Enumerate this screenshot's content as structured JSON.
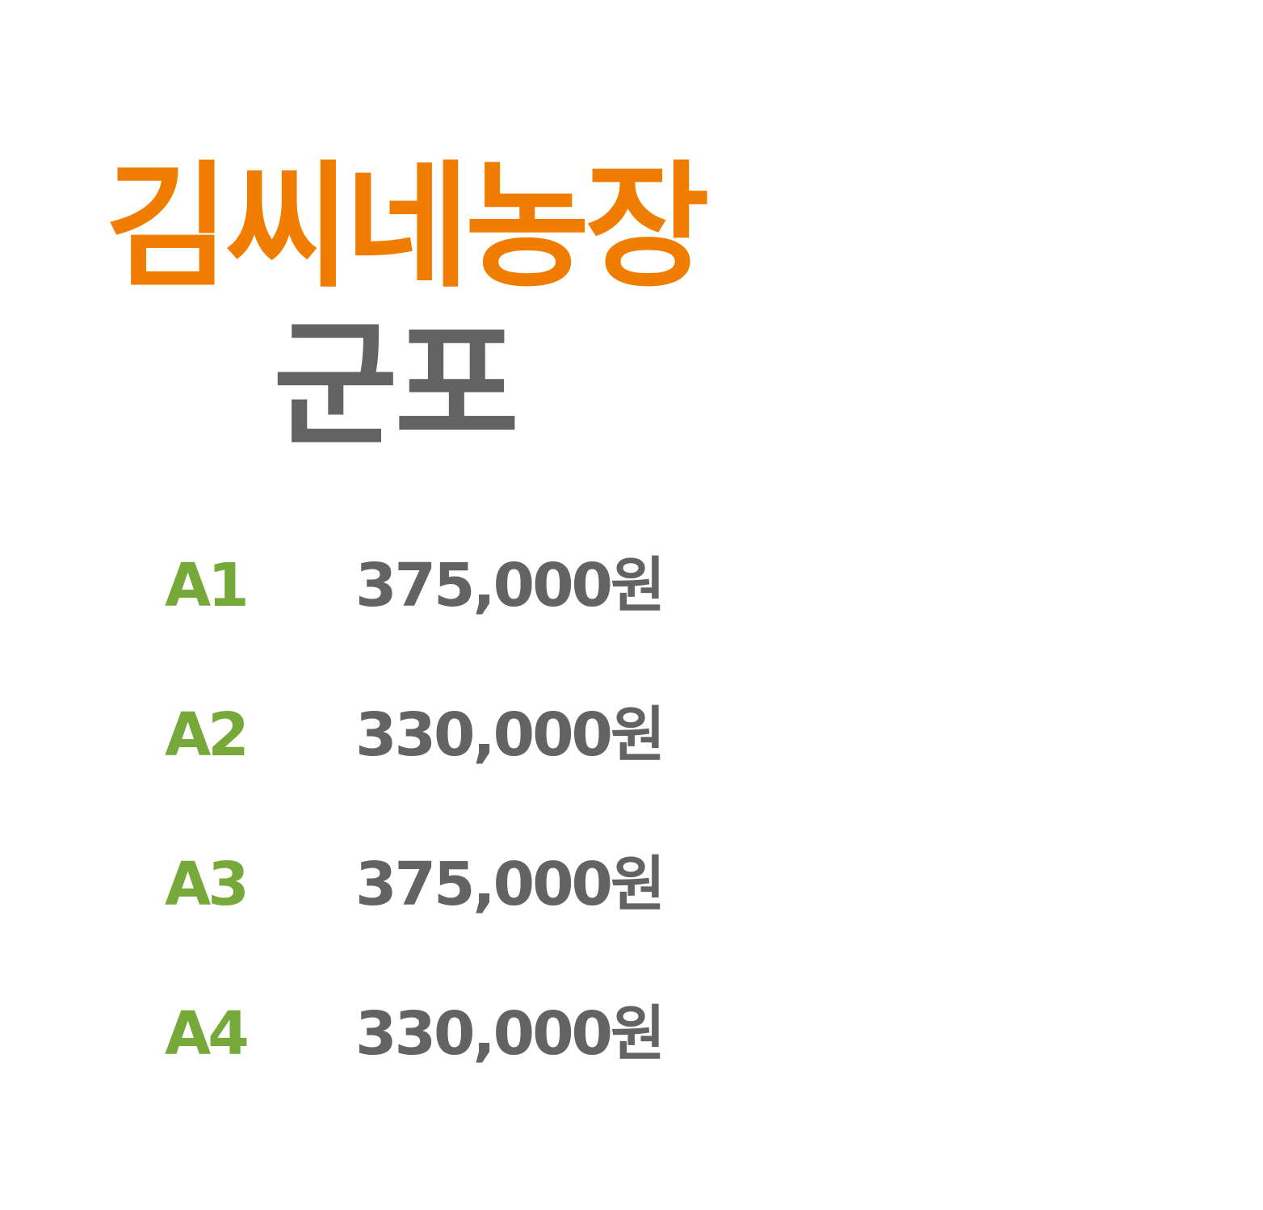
{
  "title": "김씨네농장",
  "location": "군포",
  "colors": {
    "title": "#f07d00",
    "location": "#636363",
    "grade": "#76a83a",
    "price": "#636363"
  },
  "prices": [
    {
      "grade": "A1",
      "price": "375,000원"
    },
    {
      "grade": "A2",
      "price": "330,000원"
    },
    {
      "grade": "A3",
      "price": "375,000원"
    },
    {
      "grade": "A4",
      "price": "330,000원"
    }
  ]
}
